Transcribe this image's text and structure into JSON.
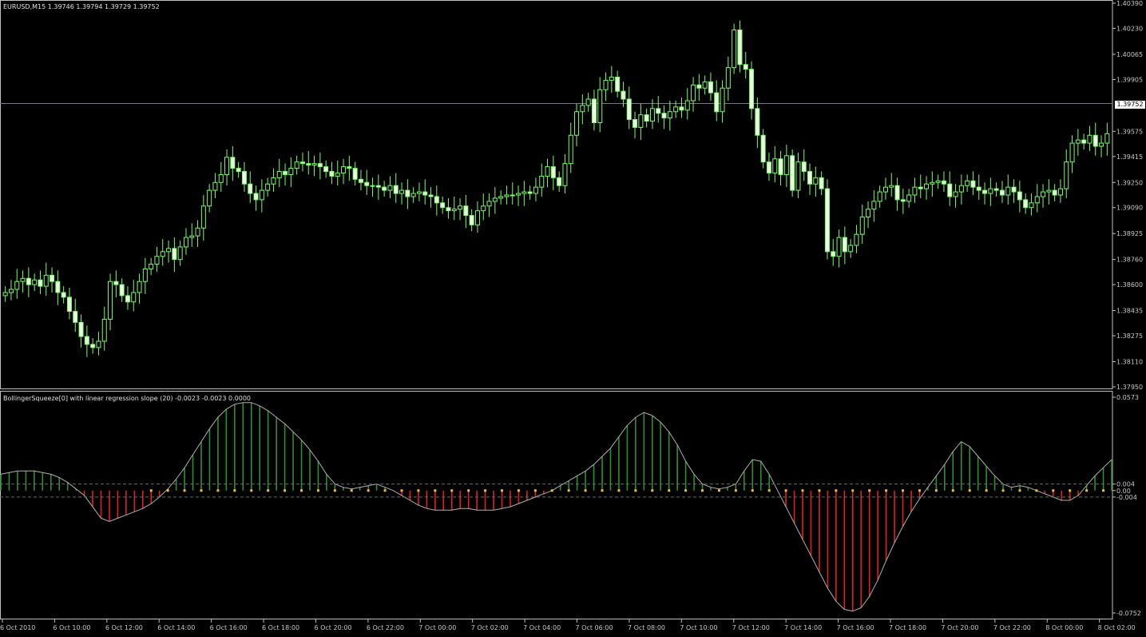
{
  "main_title": "EURUSD,M15  1.39746 1.39794 1.39729 1.39752",
  "indicator_title": "BollingerSqueeze[0] with linear regression slope (20) -0.0023 -0.0023 0.0000",
  "current_price_label": "1.39752",
  "colors": {
    "background": "#000000",
    "axis": "#c0c0c0",
    "candle": "#7cfc6c",
    "bull_body": "#000000",
    "bear_body": "#eaffe0",
    "price_line": "#6b7c8c",
    "hist_up": "#2f8f2f",
    "hist_down": "#e02020",
    "squeeze_dot": "#e8c040",
    "curve": "#b0b0b0",
    "level_line": "#607070"
  },
  "chart_data": [
    {
      "type": "candlestick",
      "title": "EURUSD,M15  1.39746 1.39794 1.39729 1.39752",
      "y_ticks": [
        "1.40390",
        "1.40230",
        "1.40065",
        "1.39905",
        "1.39575",
        "1.39415",
        "1.39250",
        "1.39090",
        "1.38925",
        "1.38760",
        "1.38600",
        "1.38435",
        "1.38275",
        "1.38110",
        "1.37950"
      ],
      "ylim": [
        1.3795,
        1.4039
      ],
      "current_price": 1.39752,
      "x_ticks": [
        "6 Oct 2010",
        "6 Oct 10:00",
        "6 Oct 12:00",
        "6 Oct 14:00",
        "6 Oct 16:00",
        "6 Oct 18:00",
        "6 Oct 20:00",
        "6 Oct 22:00",
        "7 Oct 00:00",
        "7 Oct 02:00",
        "7 Oct 04:00",
        "7 Oct 06:00",
        "7 Oct 08:00",
        "7 Oct 10:00",
        "7 Oct 12:00",
        "7 Oct 14:00",
        "7 Oct 16:00",
        "7 Oct 18:00",
        "7 Oct 20:00",
        "7 Oct 22:00",
        "8 Oct 00:00",
        "8 Oct 02:00"
      ],
      "closes": [
        1.3855,
        1.3857,
        1.3862,
        1.3864,
        1.386,
        1.3863,
        1.3859,
        1.3866,
        1.3862,
        1.3855,
        1.3852,
        1.3843,
        1.3836,
        1.3827,
        1.3822,
        1.382,
        1.3824,
        1.3838,
        1.3862,
        1.386,
        1.3853,
        1.3849,
        1.3855,
        1.3862,
        1.387,
        1.3873,
        1.3878,
        1.3881,
        1.3883,
        1.3876,
        1.3884,
        1.389,
        1.3891,
        1.3896,
        1.391,
        1.392,
        1.3925,
        1.393,
        1.3941,
        1.3934,
        1.3932,
        1.3924,
        1.3918,
        1.3914,
        1.392,
        1.3924,
        1.3928,
        1.3932,
        1.393,
        1.3934,
        1.3938,
        1.3937,
        1.3936,
        1.3937,
        1.3935,
        1.3932,
        1.3929,
        1.3931,
        1.3935,
        1.3934,
        1.3927,
        1.3925,
        1.3923,
        1.3923,
        1.3922,
        1.392,
        1.3923,
        1.3918,
        1.392,
        1.3916,
        1.3918,
        1.3919,
        1.3917,
        1.3916,
        1.3912,
        1.3909,
        1.3907,
        1.3908,
        1.391,
        1.3904,
        1.3898,
        1.3907,
        1.391,
        1.3913,
        1.3915,
        1.3916,
        1.3917,
        1.3917,
        1.3918,
        1.3919,
        1.3918,
        1.3922,
        1.3929,
        1.3935,
        1.3928,
        1.3923,
        1.3937,
        1.3955,
        1.397,
        1.3974,
        1.3978,
        1.3963,
        1.3984,
        1.399,
        1.3992,
        1.3983,
        1.3978,
        1.3965,
        1.396,
        1.3968,
        1.3964,
        1.3972,
        1.3969,
        1.3966,
        1.397,
        1.3973,
        1.3971,
        1.3977,
        1.3987,
        1.3985,
        1.3989,
        1.3982,
        1.397,
        1.3985,
        1.3998,
        1.4022,
        1.4,
        1.3997,
        1.3972,
        1.3955,
        1.3938,
        1.3931,
        1.394,
        1.393,
        1.3942,
        1.392,
        1.3938,
        1.3932,
        1.3924,
        1.3928,
        1.3921,
        1.3881,
        1.3878,
        1.389,
        1.3881,
        1.3885,
        1.3892,
        1.3903,
        1.3908,
        1.3913,
        1.3919,
        1.3922,
        1.3923,
        1.3914,
        1.3913,
        1.3917,
        1.3922,
        1.3921,
        1.3924,
        1.3925,
        1.3926,
        1.3924,
        1.3916,
        1.3919,
        1.3923,
        1.3926,
        1.3922,
        1.392,
        1.3918,
        1.3921,
        1.392,
        1.3917,
        1.3922,
        1.3919,
        1.3914,
        1.3909,
        1.3912,
        1.3916,
        1.3919,
        1.392,
        1.3917,
        1.3921,
        1.3938,
        1.395,
        1.3952,
        1.395,
        1.3955,
        1.3948,
        1.395,
        1.3956
      ]
    },
    {
      "type": "histogram",
      "title": "BollingerSqueeze[0] with linear regression slope (20) -0.0023 -0.0023 0.0000",
      "y_ticks": [
        "0.0573",
        "0.004",
        "0.00",
        "-0.004",
        "-0.0752"
      ],
      "ylim": [
        -0.0752,
        0.0573
      ],
      "levels": [
        0.004,
        -0.004
      ],
      "values": [
        0.01,
        0.011,
        0.012,
        0.012,
        0.012,
        0.011,
        0.01,
        0.008,
        0.005,
        0.001,
        -0.003,
        -0.01,
        -0.017,
        -0.019,
        -0.017,
        -0.015,
        -0.013,
        -0.011,
        -0.008,
        -0.004,
        0.001,
        0.007,
        0.014,
        0.022,
        0.03,
        0.038,
        0.045,
        0.05,
        0.053,
        0.054,
        0.054,
        0.052,
        0.049,
        0.045,
        0.041,
        0.036,
        0.031,
        0.025,
        0.018,
        0.01,
        0.004,
        0.002,
        0.001,
        0.002,
        0.003,
        0.004,
        0.002,
        0.0,
        -0.003,
        -0.006,
        -0.009,
        -0.011,
        -0.012,
        -0.012,
        -0.012,
        -0.011,
        -0.011,
        -0.012,
        -0.012,
        -0.012,
        -0.011,
        -0.01,
        -0.008,
        -0.006,
        -0.004,
        -0.002,
        0.0,
        0.003,
        0.006,
        0.009,
        0.012,
        0.016,
        0.021,
        0.026,
        0.033,
        0.04,
        0.045,
        0.048,
        0.046,
        0.042,
        0.036,
        0.028,
        0.018,
        0.01,
        0.004,
        0.002,
        0.001,
        0.002,
        0.004,
        0.012,
        0.019,
        0.018,
        0.01,
        0.0,
        -0.01,
        -0.02,
        -0.03,
        -0.04,
        -0.05,
        -0.06,
        -0.068,
        -0.073,
        -0.074,
        -0.072,
        -0.065,
        -0.055,
        -0.043,
        -0.032,
        -0.022,
        -0.013,
        -0.005,
        0.002,
        0.009,
        0.016,
        0.024,
        0.03,
        0.027,
        0.021,
        0.015,
        0.009,
        0.004,
        0.002,
        0.003,
        0.002,
        0.0,
        -0.002,
        -0.004,
        -0.006,
        -0.006,
        -0.003,
        0.003,
        0.009,
        0.014,
        0.019
      ]
    }
  ]
}
